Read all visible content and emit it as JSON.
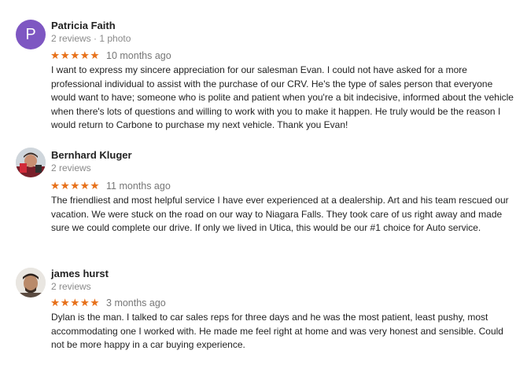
{
  "colors": {
    "star": "#e7711b",
    "avatar_p": "#7e57c2",
    "meta_text": "#8a8a8a"
  },
  "reviews": [
    {
      "name": "Patricia Faith",
      "avatar_letter": "P",
      "avatar_type": "letter",
      "meta": "2 reviews · 1 photo",
      "stars": "★★★★★",
      "rating": 5,
      "time": "10 months ago",
      "text": "I want to express my sincere appreciation for our salesman Evan. I could not have asked for a more professional individual to assist with the purchase of our CRV. He's the type of sales person that everyone would want to have; someone who is polite and patient when you're a bit indecisive, informed about the vehicle when there's lots of questions and willing to work with you to make it happen. He truly would be the reason I would return to Carbone to purchase my next vehicle. Thank you Evan!"
    },
    {
      "name": "Bernhard Kluger",
      "avatar_type": "photo",
      "meta": "2 reviews",
      "stars": "★★★★★",
      "rating": 5,
      "time": "11 months ago",
      "text": "The friendliest and most helpful service I have ever experienced at a dealership.  Art and his team rescued our vacation.  We were stuck on the road on our way to Niagara Falls.  They took care of us right away and made sure we could complete our drive.  If only we lived in Utica, this would be our #1 choice for Auto service."
    },
    {
      "name": "james hurst",
      "avatar_type": "photo",
      "meta": "2 reviews",
      "stars": "★★★★★",
      "rating": 5,
      "time": "3 months ago",
      "text": "Dylan is the man. I talked to car sales reps for three days and he was the most patient, least pushy, most accommodating one I worked with. He made me feel right at home and was very honest and sensible. Could not be more happy in a car buying experience."
    }
  ]
}
